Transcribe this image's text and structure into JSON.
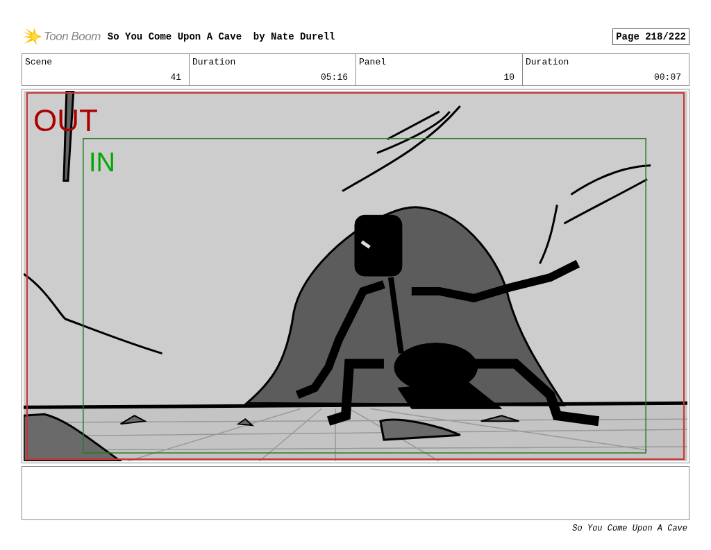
{
  "header": {
    "logo": "Toon Boom",
    "title": "So You Come Upon A Cave  by Nate Durell",
    "page": "Page 218/222"
  },
  "info": [
    {
      "label": "Scene",
      "value": "41"
    },
    {
      "label": "Duration",
      "value": "05:16"
    },
    {
      "label": "Panel",
      "value": "10"
    },
    {
      "label": "Duration",
      "value": "00:07"
    }
  ],
  "panel": {
    "out_label": "OUT",
    "in_label": "IN"
  },
  "footer": "So You Come Upon A Cave"
}
